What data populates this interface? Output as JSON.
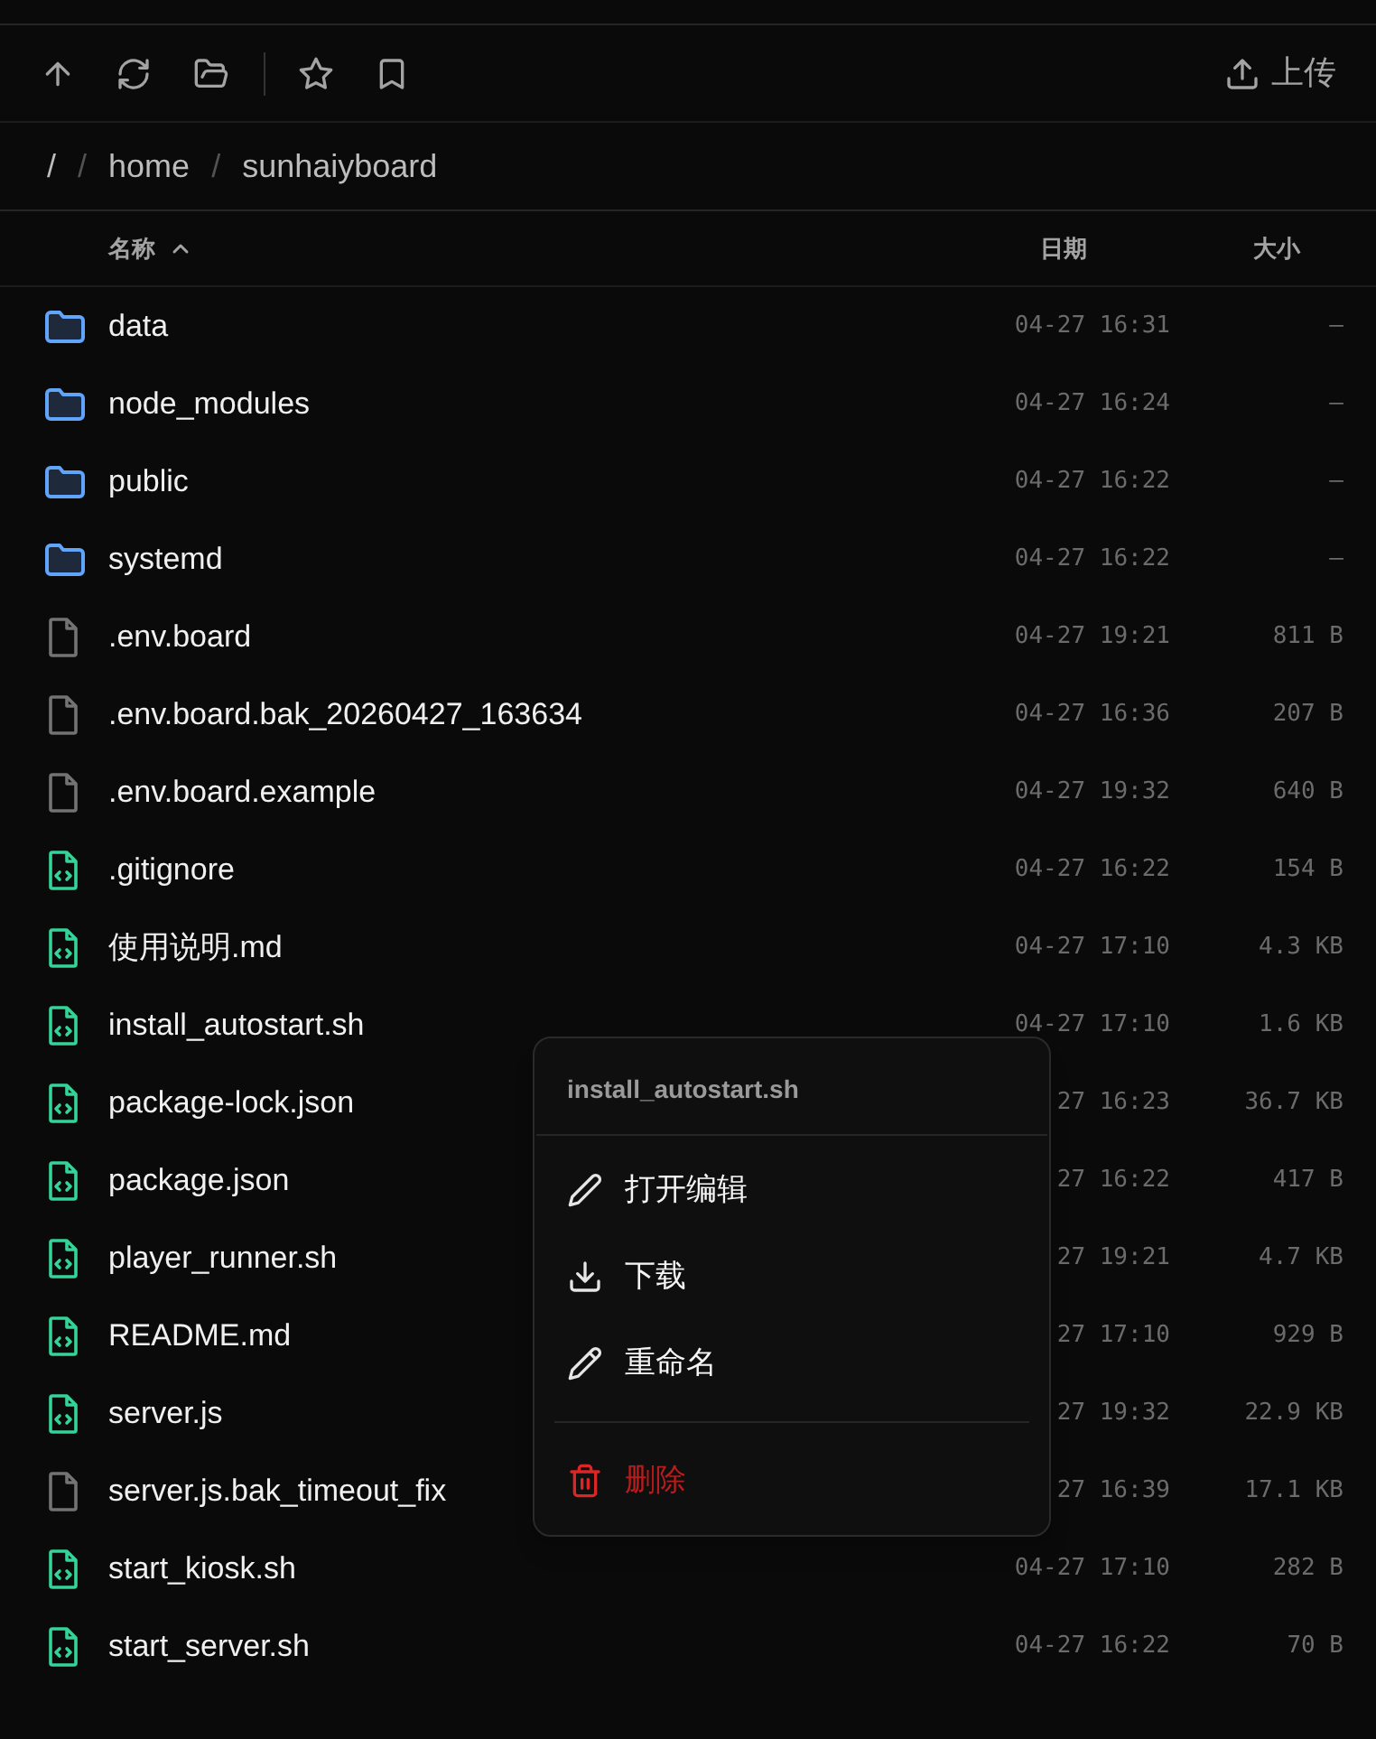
{
  "toolbar": {
    "upload_label": "上传"
  },
  "breadcrumb": {
    "separator": "/",
    "items": [
      "/",
      "home",
      "sunhaiyboard"
    ]
  },
  "table": {
    "columns": [
      {
        "label": "名称",
        "sorted": true
      },
      {
        "label": "日期",
        "sorted": false
      },
      {
        "label": "大小",
        "sorted": false
      }
    ],
    "rows": [
      {
        "kind": "folder",
        "name": "data",
        "date": "04-27 16:31",
        "size": "—"
      },
      {
        "kind": "folder",
        "name": "node_modules",
        "date": "04-27 16:24",
        "size": "—"
      },
      {
        "kind": "folder",
        "name": "public",
        "date": "04-27 16:22",
        "size": "—"
      },
      {
        "kind": "folder",
        "name": "systemd",
        "date": "04-27 16:22",
        "size": "—"
      },
      {
        "kind": "file",
        "name": ".env.board",
        "date": "04-27 19:21",
        "size": "811 B"
      },
      {
        "kind": "file",
        "name": ".env.board.bak_20260427_163634",
        "date": "04-27 16:36",
        "size": "207 B"
      },
      {
        "kind": "file",
        "name": ".env.board.example",
        "date": "04-27 19:32",
        "size": "640 B"
      },
      {
        "kind": "code",
        "name": ".gitignore",
        "date": "04-27 16:22",
        "size": "154 B"
      },
      {
        "kind": "code",
        "name": "使用说明.md",
        "date": "04-27 17:10",
        "size": "4.3 KB"
      },
      {
        "kind": "code",
        "name": "install_autostart.sh",
        "date": "04-27 17:10",
        "size": "1.6 KB"
      },
      {
        "kind": "code",
        "name": "package-lock.json",
        "date": "27 16:23",
        "size": "36.7 KB"
      },
      {
        "kind": "code",
        "name": "package.json",
        "date": "27 16:22",
        "size": "417 B"
      },
      {
        "kind": "code",
        "name": "player_runner.sh",
        "date": "27 19:21",
        "size": "4.7 KB"
      },
      {
        "kind": "code",
        "name": "README.md",
        "date": "27 17:10",
        "size": "929 B"
      },
      {
        "kind": "code",
        "name": "server.js",
        "date": "27 19:32",
        "size": "22.9 KB"
      },
      {
        "kind": "file",
        "name": "server.js.bak_timeout_fix",
        "date": "27 16:39",
        "size": "17.1 KB"
      },
      {
        "kind": "code",
        "name": "start_kiosk.sh",
        "date": "04-27 17:10",
        "size": "282 B"
      },
      {
        "kind": "code",
        "name": "start_server.sh",
        "date": "04-27 16:22",
        "size": "70 B"
      }
    ]
  },
  "context_menu": {
    "title": "install_autostart.sh",
    "items": [
      {
        "kind": "edit",
        "label": "打开编辑"
      },
      {
        "kind": "download",
        "label": "下载"
      },
      {
        "kind": "rename",
        "label": "重命名"
      },
      {
        "kind": "divider"
      },
      {
        "kind": "delete",
        "label": "删除"
      }
    ]
  }
}
